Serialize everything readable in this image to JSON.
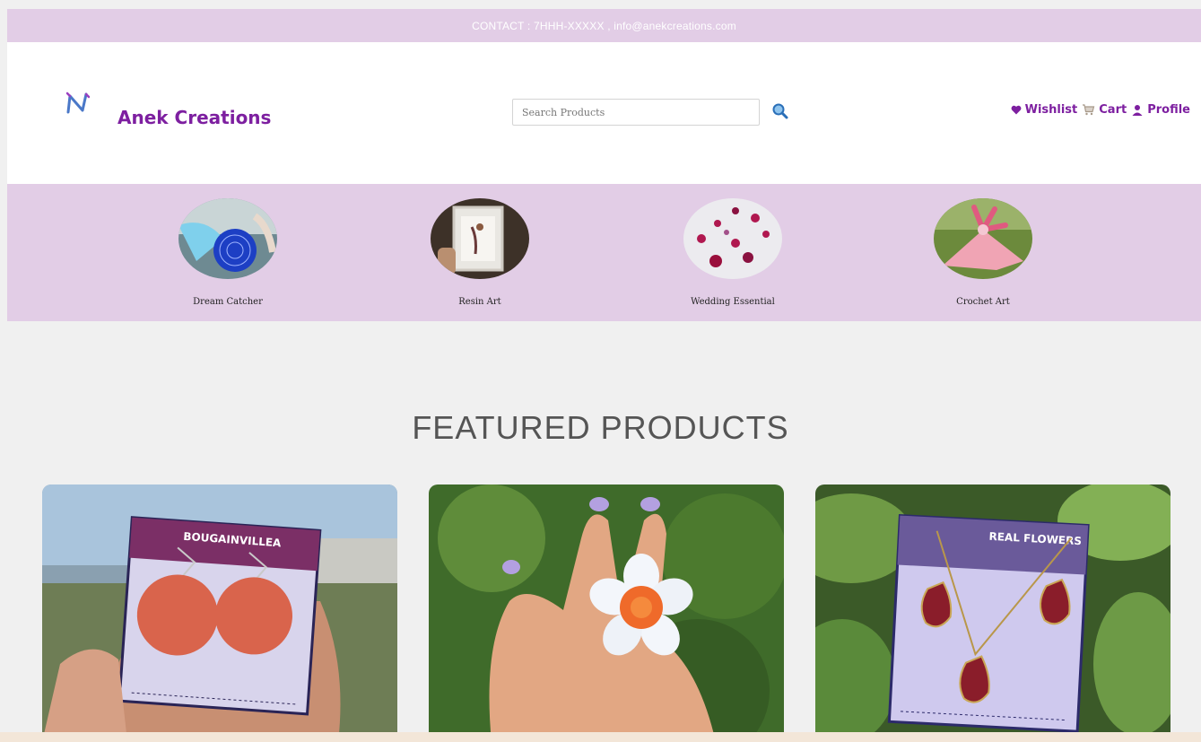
{
  "topbar": {
    "contact": "CONTACT : 7HHH-XXXXX , info@anekcreations.com"
  },
  "header": {
    "brand": "Anek Creations",
    "logo_icon": "anek-logo-icon",
    "search": {
      "placeholder": "Search Products",
      "value": "",
      "icon": "search-icon"
    },
    "nav": [
      {
        "label": "Wishlist",
        "icon": "heart-icon"
      },
      {
        "label": "Cart",
        "icon": "cart-icon"
      },
      {
        "label": "Profile",
        "icon": "user-icon"
      }
    ]
  },
  "categories": [
    {
      "label": "Dream Catcher"
    },
    {
      "label": "Resin Art"
    },
    {
      "label": "Wedding Essential"
    },
    {
      "label": "Crochet Art"
    }
  ],
  "featured": {
    "title": "FEATURED PRODUCTS",
    "products": [
      {
        "card_text": "BOUGAINVILLEA"
      },
      {
        "card_text": ""
      },
      {
        "card_text": "REAL FLOWERS"
      }
    ]
  },
  "colors": {
    "accent": "#7d1fa0",
    "band": "#e2cde6",
    "page_bg": "#f0f0f0"
  }
}
